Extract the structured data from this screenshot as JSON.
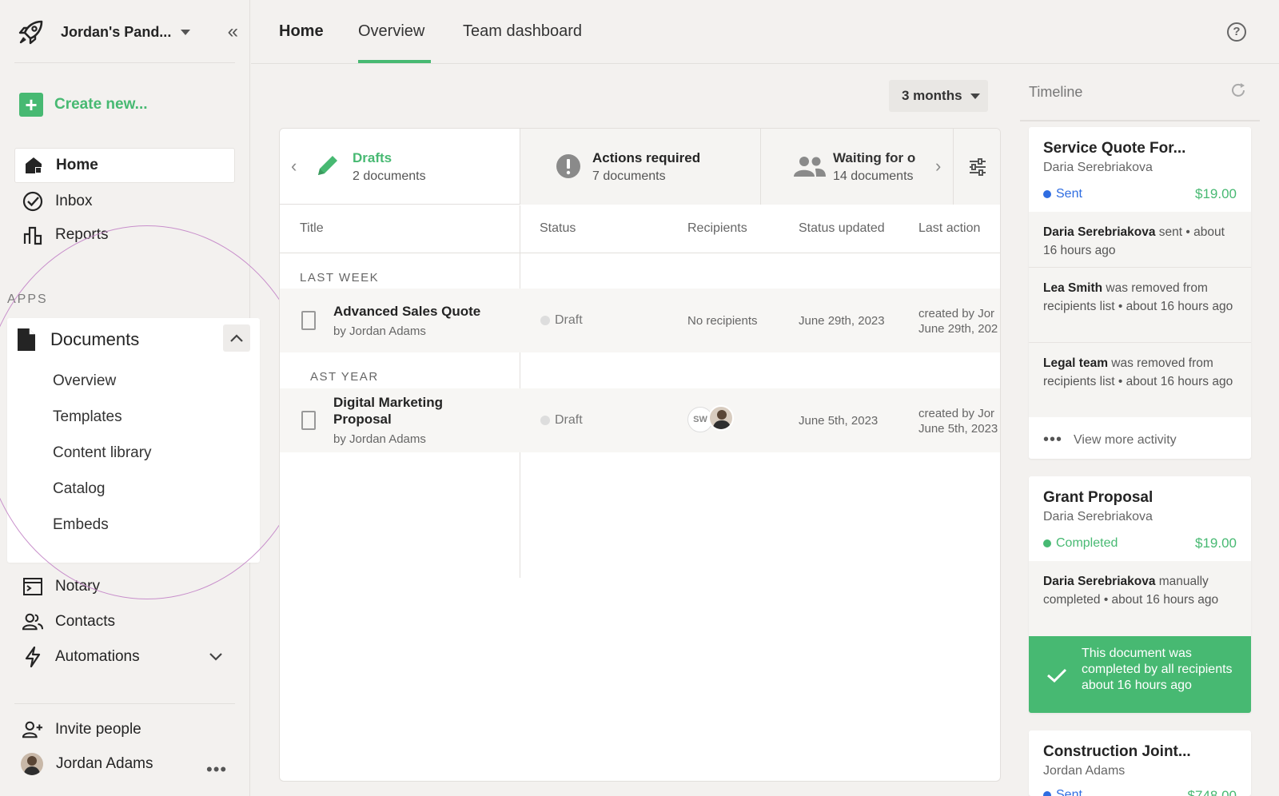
{
  "workspace": {
    "name": "Jordan's Pand..."
  },
  "sidebar": {
    "create_label": "Create new...",
    "nav": [
      {
        "label": "Home",
        "icon": "home-icon"
      },
      {
        "label": "Inbox",
        "icon": "inbox-icon"
      },
      {
        "label": "Reports",
        "icon": "reports-icon"
      }
    ],
    "apps_label": "APPS",
    "documents": {
      "title": "Documents",
      "items": [
        "Overview",
        "Templates",
        "Content library",
        "Catalog",
        "Embeds"
      ]
    },
    "more_nav": [
      {
        "label": "Notary",
        "icon": "notary-icon"
      },
      {
        "label": "Contacts",
        "icon": "contacts-icon"
      },
      {
        "label": "Automations",
        "icon": "automations-icon"
      }
    ],
    "invite_label": "Invite people",
    "user_name": "Jordan Adams"
  },
  "topnav": {
    "tabs": [
      {
        "label": "Home"
      },
      {
        "label": "Overview"
      },
      {
        "label": "Team dashboard"
      }
    ]
  },
  "filter": {
    "period": "3 months"
  },
  "summary": [
    {
      "title": "Drafts",
      "sub": "2 documents",
      "color": "#47b972"
    },
    {
      "title": "Actions required",
      "sub": "7 documents"
    },
    {
      "title": "Waiting for o",
      "sub": "14 documents"
    }
  ],
  "table": {
    "headers": [
      "Title",
      "Status",
      "Recipients",
      "Status updated",
      "Last action"
    ],
    "groups": [
      {
        "label": "LAST WEEK",
        "rows": [
          {
            "name": "Advanced Sales Quote",
            "by": "by Jordan Adams",
            "status": "Draft",
            "recipients": "No recipients",
            "updated": "June 29th, 2023",
            "last_action_1": "created by Jor",
            "last_action_2": "June 29th, 202"
          }
        ]
      },
      {
        "label": "AST YEAR",
        "rows": [
          {
            "name_1": "Digital Marketing",
            "name_2": "Proposal",
            "by": "by Jordan Adams",
            "status": "Draft",
            "recipient_initials": "SW",
            "updated": "June 5th, 2023",
            "last_action_1": "created by Jor",
            "last_action_2": "June 5th, 2023"
          }
        ]
      }
    ]
  },
  "timeline": {
    "title": "Timeline",
    "cards": [
      {
        "title": "Service Quote For...",
        "owner": "Daria Serebriakova",
        "status": "Sent",
        "status_color": "#2f6de1",
        "amount": "$19.00",
        "activities": [
          {
            "who": "Daria Serebriakova",
            "text": " sent • about 16 hours ago"
          },
          {
            "who": "Lea Smith",
            "text": " was removed from recipients list • about 16 hours ago"
          },
          {
            "who": "Legal team",
            "text": " was removed from recipients list • about 16 hours ago"
          }
        ],
        "more_label": "View more activity"
      },
      {
        "title": "Grant Proposal",
        "owner": "Daria Serebriakova",
        "status": "Completed",
        "status_color": "#47b972",
        "amount": "$19.00",
        "activities": [
          {
            "who": "Daria Serebriakova",
            "text": " manually completed • about 16 hours ago"
          }
        ],
        "completed_note": "This document was completed by all recipients about 16 hours ago"
      },
      {
        "title": "Construction Joint...",
        "owner": "Jordan Adams",
        "status": "Sent",
        "amount": "$748.00"
      }
    ]
  },
  "colors": {
    "accent": "#47b972",
    "sent": "#2f6de1",
    "highlight_ring": "#c88fcb"
  }
}
